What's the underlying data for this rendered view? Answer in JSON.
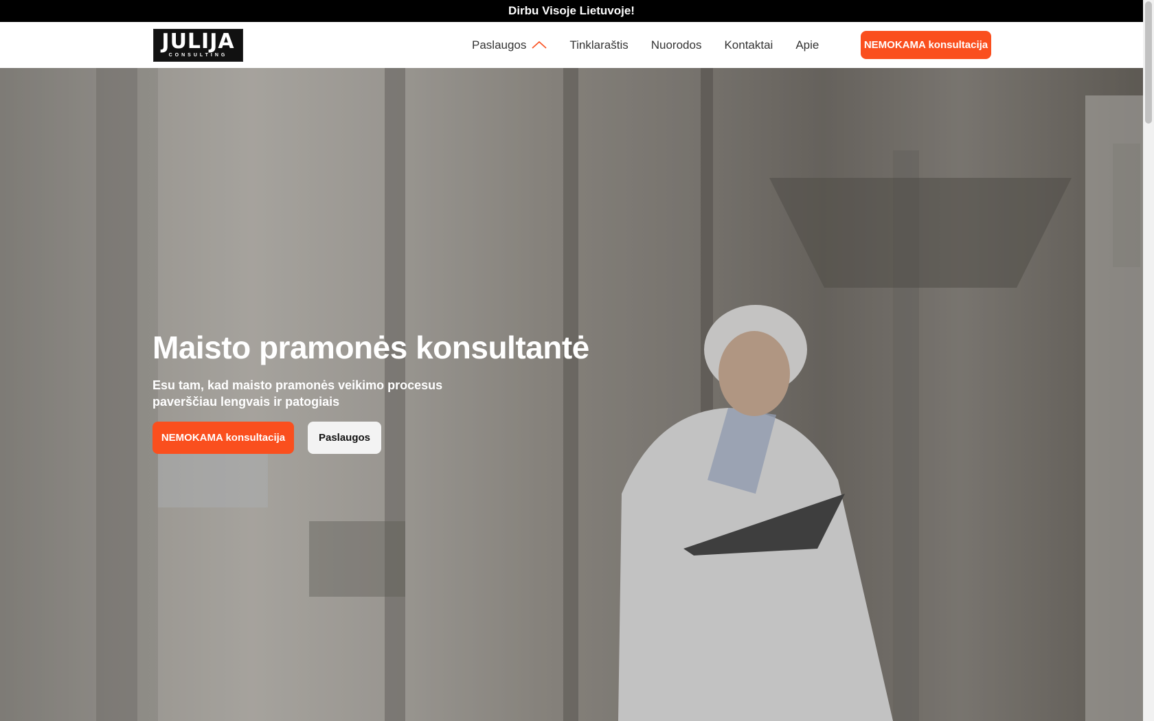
{
  "topbar": {
    "text": "Dirbu Visoje Lietuvoje!"
  },
  "header": {
    "logo": {
      "main": "JULIJA",
      "sub": "CONSULTING"
    },
    "nav": [
      "Paslaugos",
      "Tinklaraštis",
      "Nuorodos",
      "Kontaktai",
      "Apie"
    ],
    "cta": "NEMOKAMA konsultacija"
  },
  "hero": {
    "title": "Maisto pramonės konsultantė",
    "subtitle": "Esu tam, kad maisto pramonės veikimo procesus paverščiau lengvais ir patogiais",
    "cta_primary": "NEMOKAMA konsultacija",
    "cta_secondary": "Paslaugos"
  },
  "colors": {
    "accent": "#fa4f1e",
    "topbar": "#000000"
  },
  "icons": {
    "nav_dropdown": "chevron-up-icon"
  }
}
